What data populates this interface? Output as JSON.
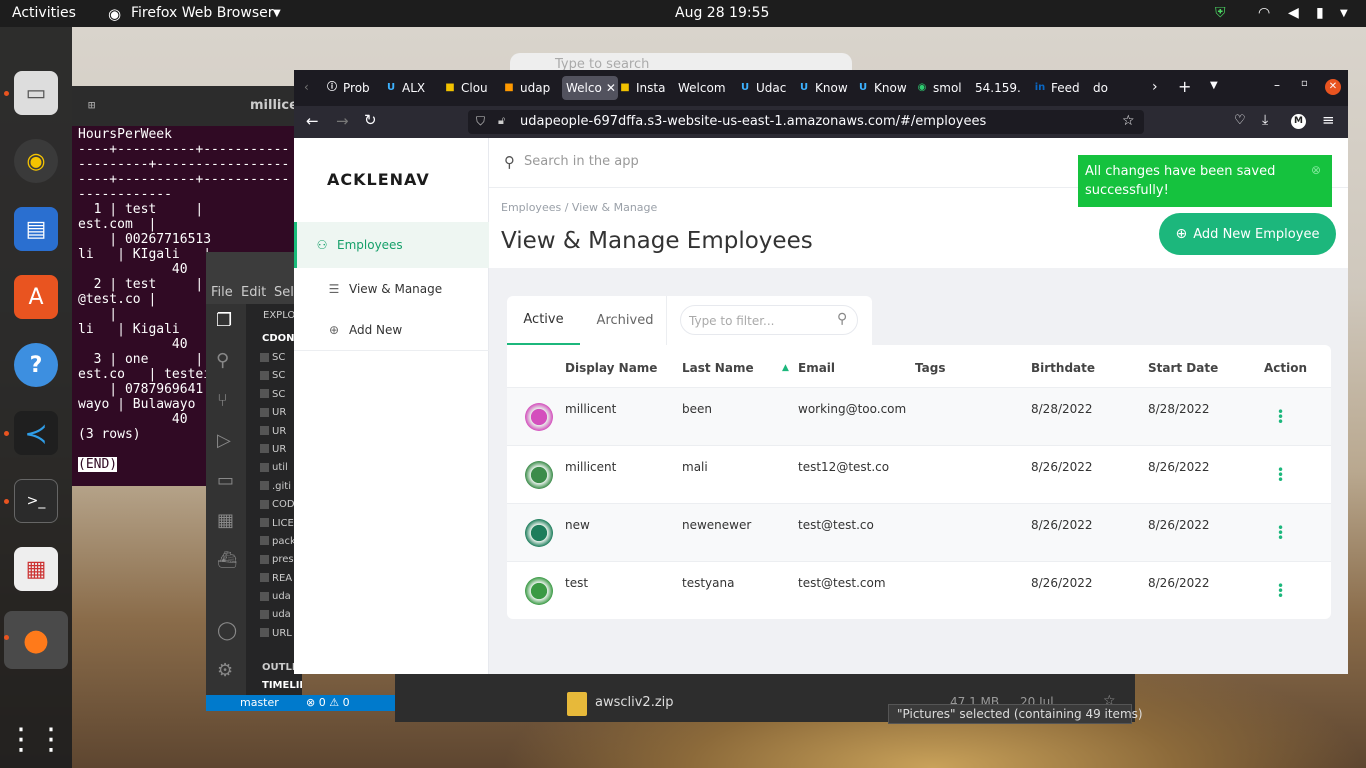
{
  "topbar": {
    "activities": "Activities",
    "app": "Firefox Web Browser",
    "datetime": "Aug 28  19:55"
  },
  "terminal": {
    "title": "millicen",
    "lines": [
      "HoursPerWeek",
      "----+----------+-----------",
      "---------+-----------------",
      "----+----------+-----------",
      "------------",
      "  1 | test     |",
      "est.com  |",
      "    | 00267716513",
      "li   | KIgali   |",
      "            40",
      "  2 | test     |",
      "@test.co |",
      "    |",
      "li   | Kigali   |",
      "            40",
      "  3 | one      |",
      "est.co   | testei",
      "    | 0787969641",
      "wayo | Bulawayo |",
      "            40",
      "(3 rows)",
      "",
      "(END)"
    ]
  },
  "vscode": {
    "menu": [
      "File",
      "Edit",
      "Sele"
    ],
    "explorer": "EXPLOR",
    "folder": "CDOND",
    "items": [
      "SC",
      "SC",
      "SC",
      "UR",
      "UR",
      "UR",
      "util",
      ".giti",
      "COD",
      "LICE",
      "pack",
      "pres",
      "REA",
      "uda",
      "uda",
      "URL"
    ],
    "outline": "OUTLIN",
    "timeline": "TIMELINE",
    "branch": "master",
    "problems": "⊗ 0 ⚠ 0"
  },
  "files": {
    "filename": "awscliv2.zip",
    "size": "47.1 MB",
    "date": "20 Jul",
    "status": "\"Pictures\" selected  (containing 49 items)"
  },
  "firefox": {
    "search_hint": "Type to search",
    "tabs": [
      {
        "label": "Prob",
        "icon": "tab-icon-generic"
      },
      {
        "label": "ALX",
        "icon": "tab-icon-udacity"
      },
      {
        "label": "Clou",
        "icon": "tab-icon-aws"
      },
      {
        "label": "udap",
        "icon": "tab-icon-aws-box"
      },
      {
        "label": "Welco",
        "icon": "tab-icon-none"
      },
      {
        "label": "Insta",
        "icon": "tab-icon-aws"
      },
      {
        "label": "Welcom",
        "icon": "tab-icon-none"
      },
      {
        "label": "Udac",
        "icon": "tab-icon-udacity"
      },
      {
        "label": "Know",
        "icon": "tab-icon-udacity"
      },
      {
        "label": "Know",
        "icon": "tab-icon-udacity"
      },
      {
        "label": "smol",
        "icon": "tab-icon-smol"
      },
      {
        "label": "54.159.",
        "icon": "tab-icon-none"
      },
      {
        "label": "Feed",
        "icon": "tab-icon-linkedin"
      },
      {
        "label": "do",
        "icon": "tab-icon-none"
      }
    ],
    "url": "udapeople-697dffa.s3-website-us-east-1.amazonaws.com/#/employees"
  },
  "app": {
    "logo": "ACKLENAV",
    "search_placeholder": "Search in the app",
    "nav": [
      "Employees",
      "View & Manage",
      "Add New"
    ],
    "breadcrumb": "Employees   /   View & Manage",
    "title": "View & Manage Employees",
    "add_button": "Add New Employee",
    "toast": "All changes have been saved successfully!",
    "tabs": [
      "Active",
      "Archived"
    ],
    "filter_placeholder": "Type to filter...",
    "columns": [
      "Display Name",
      "Last Name",
      "Email",
      "Tags",
      "Birthdate",
      "Start Date",
      "Action"
    ],
    "rows": [
      {
        "display": "millicent",
        "last": "been",
        "email": "working@too.com",
        "tags": "",
        "birth": "8/28/2022",
        "start": "8/28/2022",
        "avatar": "#d44fbd"
      },
      {
        "display": "millicent",
        "last": "mali",
        "email": "test12@test.co",
        "tags": "",
        "birth": "8/26/2022",
        "start": "8/26/2022",
        "avatar": "#3c8c4a"
      },
      {
        "display": "new",
        "last": "newenewer",
        "email": "test@test.co",
        "tags": "",
        "birth": "8/26/2022",
        "start": "8/26/2022",
        "avatar": "#1d7d5b"
      },
      {
        "display": "test",
        "last": "testyana",
        "email": "test@test.com",
        "tags": "",
        "birth": "8/26/2022",
        "start": "8/26/2022",
        "avatar": "#3a9a44"
      }
    ]
  },
  "colors": {
    "accent": "#1cb77c",
    "toast": "#15c23e"
  }
}
